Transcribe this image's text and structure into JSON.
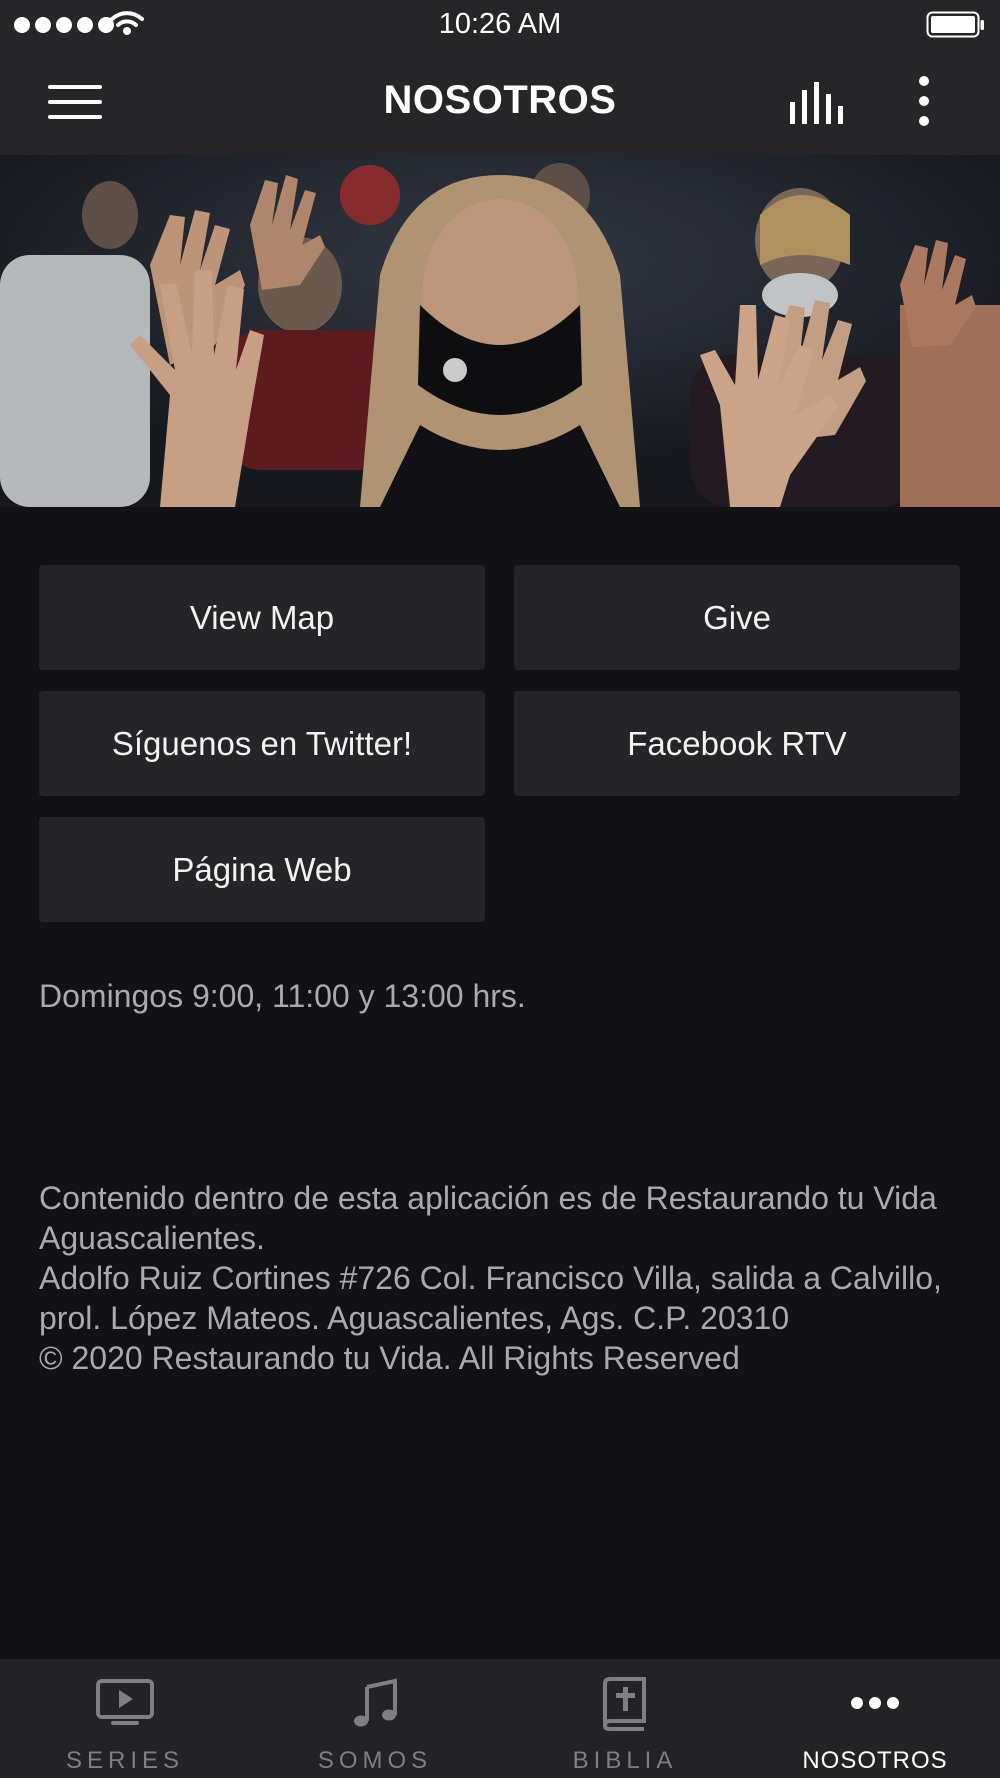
{
  "status_bar": {
    "time": "10:26 AM"
  },
  "nav": {
    "title": "NOSOTROS"
  },
  "buttons": {
    "view_map": "View Map",
    "give": "Give",
    "twitter": "Síguenos en Twitter!",
    "facebook": "Facebook RTV",
    "web": "Página Web"
  },
  "schedule": "Domingos 9:00, 11:00 y 13:00 hrs.",
  "footer": {
    "line1": "Contenido dentro de esta aplicación es de Restaurando tu Vida Aguascalientes.",
    "line2": "Adolfo Ruiz Cortines #726 Col. Francisco Villa, salida a Calvillo, prol. López Mateos. Aguascalientes, Ags. C.P. 20310",
    "line3": "© 2020 Restaurando tu Vida. All Rights Reserved"
  },
  "tabs": [
    {
      "label": "SERIES",
      "icon": "tv-play-icon"
    },
    {
      "label": "SOMOS",
      "icon": "music-note-icon"
    },
    {
      "label": "BIBLIA",
      "icon": "bible-icon"
    },
    {
      "label": "NOSOTROS",
      "icon": "more-dots-icon",
      "active": true
    }
  ],
  "colors": {
    "background": "#121214",
    "bar": "#262628",
    "button": "#252527",
    "muted_text": "#a9a9ae",
    "tab_inactive": "#7e7e83"
  }
}
